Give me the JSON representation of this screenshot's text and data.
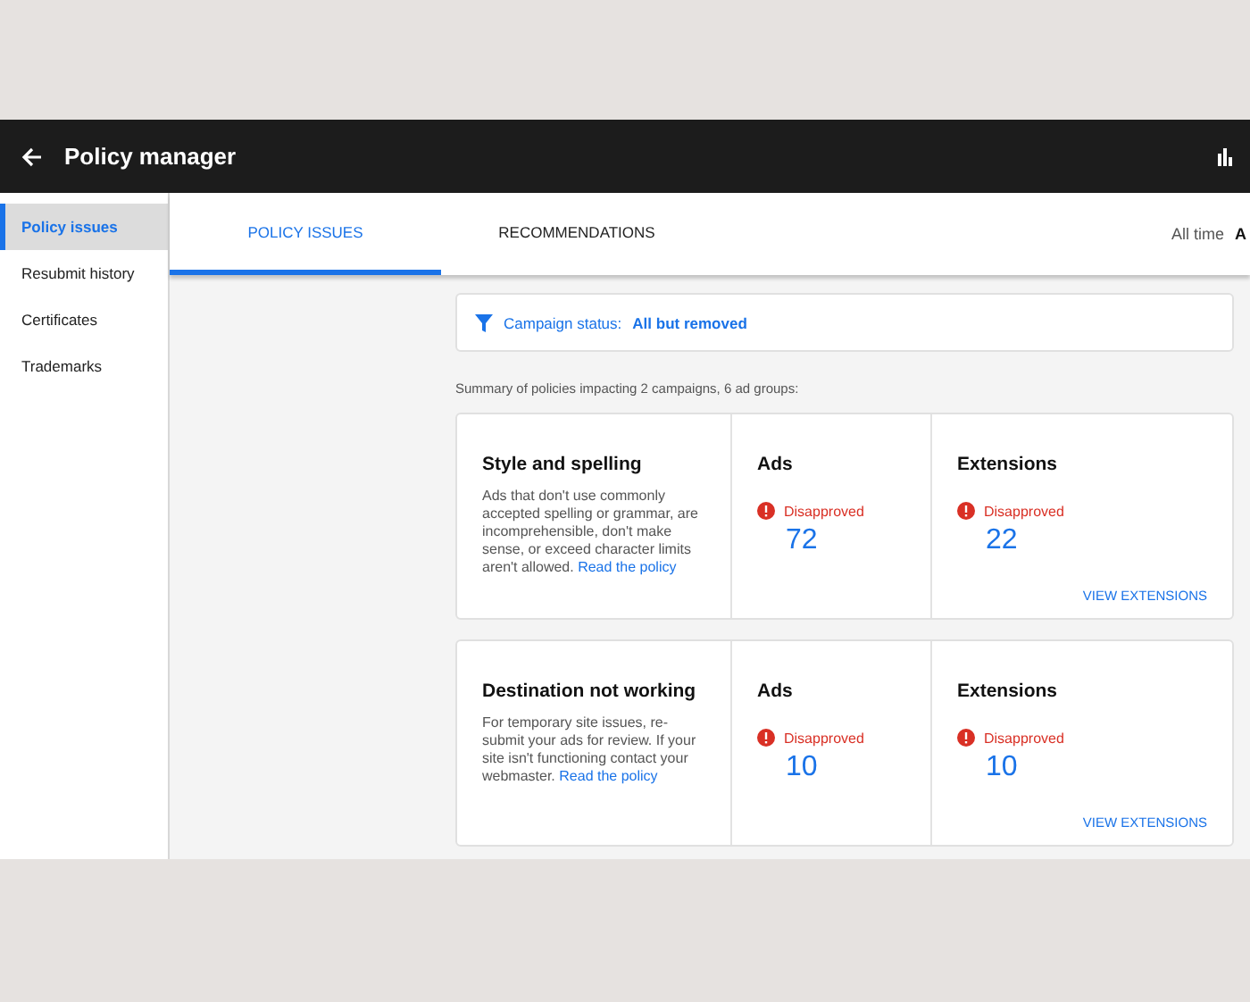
{
  "header": {
    "title": "Policy manager"
  },
  "sidebar": {
    "items": [
      {
        "label": "Policy issues",
        "selected": true
      },
      {
        "label": "Resubmit history",
        "selected": false
      },
      {
        "label": "Certificates",
        "selected": false
      },
      {
        "label": "Trademarks",
        "selected": false
      }
    ]
  },
  "tabs": [
    {
      "label": "POLICY ISSUES",
      "selected": true
    },
    {
      "label": "RECOMMENDATIONS",
      "selected": false
    }
  ],
  "date_range": {
    "label": "All time",
    "value": "A"
  },
  "filter": {
    "label": "Campaign status:",
    "value": "All but removed"
  },
  "summary": "Summary of policies impacting 2 campaigns, 6 ad groups:",
  "policies": [
    {
      "title": "Style and spelling",
      "description": "Ads that don't use commonly accepted spelling or grammar, are incomprehensible, don't make sense, or exceed character limits aren't allowed.",
      "link": "Read the policy",
      "ads": {
        "label": "Ads",
        "status": "Disapproved",
        "count": "72"
      },
      "extensions": {
        "label": "Extensions",
        "status": "Disapproved",
        "count": "22",
        "action": "VIEW EXTENSIONS"
      }
    },
    {
      "title": "Destination not working",
      "description": "For temporary site issues, re-submit your ads for review. If your site isn't functioning contact your webmaster.",
      "link": "Read the policy",
      "ads": {
        "label": "Ads",
        "status": "Disapproved",
        "count": "10"
      },
      "extensions": {
        "label": "Extensions",
        "status": "Disapproved",
        "count": "10",
        "action": "VIEW EXTENSIONS"
      }
    }
  ]
}
